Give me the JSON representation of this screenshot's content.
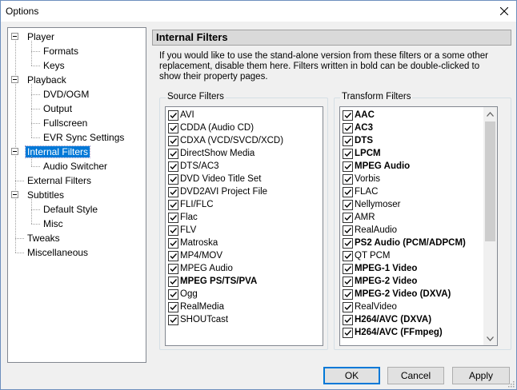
{
  "window": {
    "title": "Options"
  },
  "tree": [
    {
      "label": "Player",
      "children": [
        "Formats",
        "Keys"
      ]
    },
    {
      "label": "Playback",
      "children": [
        "DVD/OGM",
        "Output",
        "Fullscreen",
        "EVR Sync Settings"
      ]
    },
    {
      "label": "Internal Filters",
      "children": [
        "Audio Switcher"
      ],
      "selected": true
    },
    {
      "label": "External Filters",
      "children": []
    },
    {
      "label": "Subtitles",
      "children": [
        "Default Style",
        "Misc"
      ]
    },
    {
      "label": "Tweaks",
      "children": []
    },
    {
      "label": "Miscellaneous",
      "children": []
    }
  ],
  "panel": {
    "title": "Internal Filters",
    "description": "If you would like to use the stand-alone version from these filters or a some other replacement, disable them here. Filters written in bold can be double-clicked to show their property pages."
  },
  "source_filters": {
    "label": "Source Filters",
    "items": [
      {
        "label": "AVI",
        "checked": true,
        "bold": false
      },
      {
        "label": "CDDA (Audio CD)",
        "checked": true,
        "bold": false
      },
      {
        "label": "CDXA (VCD/SVCD/XCD)",
        "checked": true,
        "bold": false
      },
      {
        "label": "DirectShow Media",
        "checked": true,
        "bold": false
      },
      {
        "label": "DTS/AC3",
        "checked": true,
        "bold": false
      },
      {
        "label": "DVD Video Title Set",
        "checked": true,
        "bold": false
      },
      {
        "label": "DVD2AVI Project File",
        "checked": true,
        "bold": false
      },
      {
        "label": "FLI/FLC",
        "checked": true,
        "bold": false
      },
      {
        "label": "Flac",
        "checked": true,
        "bold": false
      },
      {
        "label": "FLV",
        "checked": true,
        "bold": false
      },
      {
        "label": "Matroska",
        "checked": true,
        "bold": false
      },
      {
        "label": "MP4/MOV",
        "checked": true,
        "bold": false
      },
      {
        "label": "MPEG Audio",
        "checked": true,
        "bold": false
      },
      {
        "label": "MPEG PS/TS/PVA",
        "checked": true,
        "bold": true
      },
      {
        "label": "Ogg",
        "checked": true,
        "bold": false
      },
      {
        "label": "RealMedia",
        "checked": true,
        "bold": false
      },
      {
        "label": "SHOUTcast",
        "checked": true,
        "bold": false
      }
    ]
  },
  "transform_filters": {
    "label": "Transform Filters",
    "items": [
      {
        "label": "AAC",
        "checked": true,
        "bold": true
      },
      {
        "label": "AC3",
        "checked": true,
        "bold": true
      },
      {
        "label": "DTS",
        "checked": true,
        "bold": true
      },
      {
        "label": "LPCM",
        "checked": true,
        "bold": true
      },
      {
        "label": "MPEG Audio",
        "checked": true,
        "bold": true
      },
      {
        "label": "Vorbis",
        "checked": true,
        "bold": false
      },
      {
        "label": "FLAC",
        "checked": true,
        "bold": false
      },
      {
        "label": "Nellymoser",
        "checked": true,
        "bold": false
      },
      {
        "label": "AMR",
        "checked": true,
        "bold": false
      },
      {
        "label": "RealAudio",
        "checked": true,
        "bold": false
      },
      {
        "label": "PS2 Audio (PCM/ADPCM)",
        "checked": true,
        "bold": true
      },
      {
        "label": "QT PCM",
        "checked": true,
        "bold": false
      },
      {
        "label": "MPEG-1 Video",
        "checked": true,
        "bold": true
      },
      {
        "label": "MPEG-2 Video",
        "checked": true,
        "bold": true
      },
      {
        "label": "MPEG-2 Video (DXVA)",
        "checked": true,
        "bold": true
      },
      {
        "label": "RealVideo",
        "checked": true,
        "bold": false
      },
      {
        "label": "H264/AVC (DXVA)",
        "checked": true,
        "bold": true
      },
      {
        "label": "H264/AVC (FFmpeg)",
        "checked": true,
        "bold": true
      }
    ]
  },
  "buttons": {
    "ok": "OK",
    "cancel": "Cancel",
    "apply": "Apply"
  },
  "colors": {
    "selection": "#0078d7",
    "window_bg": "#f0f0f0"
  }
}
